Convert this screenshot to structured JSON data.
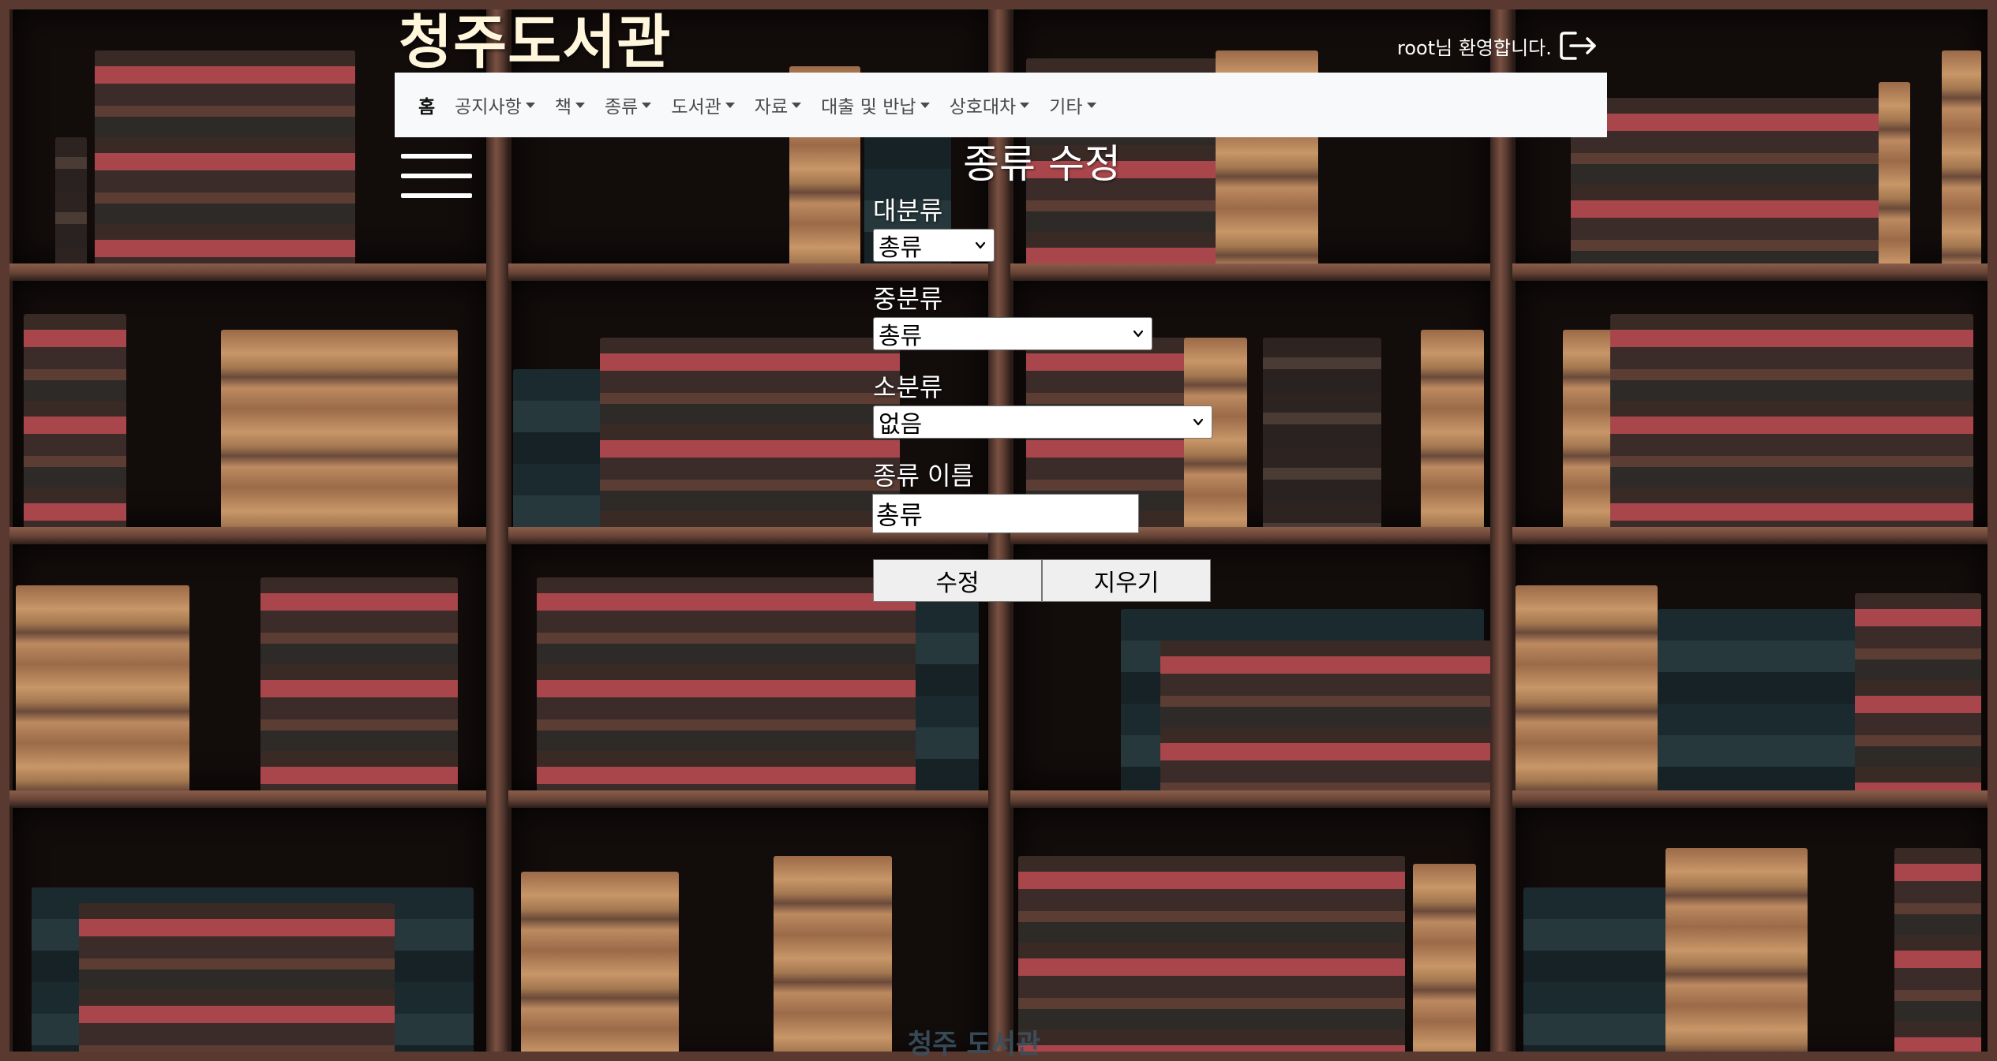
{
  "header": {
    "site_title": "청주도서관",
    "welcome_text": "root님 환영합니다."
  },
  "nav": {
    "items": [
      {
        "label": "홈",
        "active": true,
        "dropdown": false
      },
      {
        "label": "공지사항",
        "active": false,
        "dropdown": true
      },
      {
        "label": "책",
        "active": false,
        "dropdown": true
      },
      {
        "label": "종류",
        "active": false,
        "dropdown": true
      },
      {
        "label": "도서관",
        "active": false,
        "dropdown": true
      },
      {
        "label": "자료",
        "active": false,
        "dropdown": true
      },
      {
        "label": "대출 및 반납",
        "active": false,
        "dropdown": true
      },
      {
        "label": "상호대차",
        "active": false,
        "dropdown": true
      },
      {
        "label": "기타",
        "active": false,
        "dropdown": true
      }
    ]
  },
  "form": {
    "title": "종류 수정",
    "major": {
      "label": "대분류",
      "selected": "총류"
    },
    "middle": {
      "label": "중분류",
      "selected": "총류"
    },
    "minor": {
      "label": "소분류",
      "selected": "없음"
    },
    "name": {
      "label": "종류 이름",
      "value": "총류"
    },
    "submit_label": "수정",
    "clear_label": "지우기"
  },
  "footer": {
    "text": "청주 도서관"
  },
  "icons": {
    "logout": "logout-icon",
    "menu": "hamburger-menu-icon",
    "dropdown": "chevron-down-icon"
  },
  "colors": {
    "navbar_bg": "#f8f9fa",
    "title_color": "#fff6dc",
    "background": "#2b1c17"
  }
}
